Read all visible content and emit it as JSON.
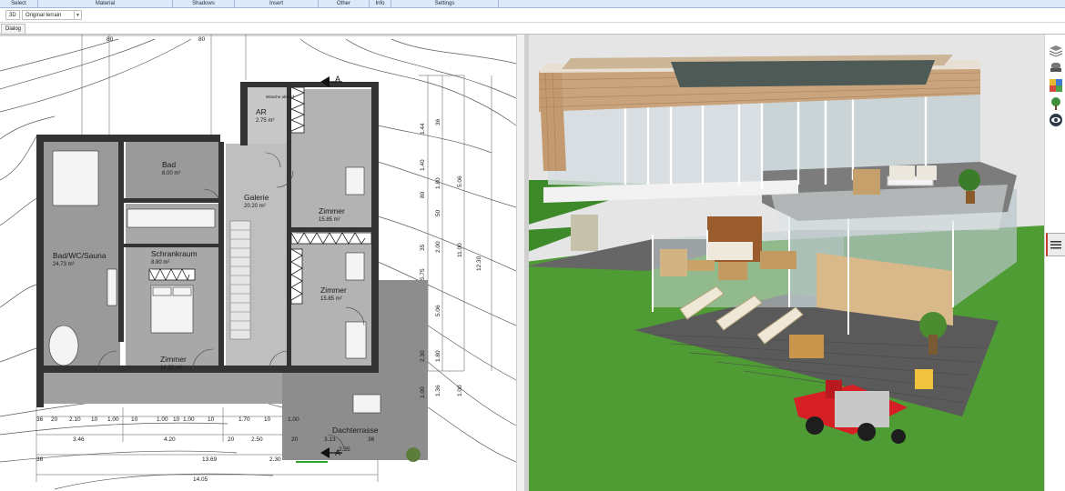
{
  "menu": {
    "items": [
      {
        "label": "Select"
      },
      {
        "label": "Material"
      },
      {
        "label": "Shadows"
      },
      {
        "label": "Insert"
      },
      {
        "label": "Other"
      },
      {
        "label": "Info"
      },
      {
        "label": "Settings"
      }
    ]
  },
  "toolbar": {
    "view_mode": "3D",
    "terrain_option": "Original terrain"
  },
  "tabs": {
    "dialog": "Dialog"
  },
  "floorplan": {
    "rooms": [
      {
        "name": "AR",
        "area": "2.75 m²"
      },
      {
        "name": "Bad",
        "area": "8.00 m²"
      },
      {
        "name": "Galerie",
        "area": "20.20 m²"
      },
      {
        "name": "Zimmer",
        "area": "15.85 m²"
      },
      {
        "name": "Bad/WC/Sauna",
        "area": "24.73 m²"
      },
      {
        "name": "Schrankraum",
        "area": "8.80 m²"
      },
      {
        "name": "Zimmer",
        "area": "15.85 m²"
      },
      {
        "name": "Zimmer",
        "area": "14.32 m²"
      },
      {
        "name": "Dachterrasse",
        "area": ""
      }
    ],
    "washer_label": "Wäsche abwurf",
    "top_dims": [
      "80",
      "80"
    ],
    "bottom_dims_row1": [
      "36",
      "20",
      "2.10",
      "10",
      "1.00",
      "10",
      "1.00",
      "10",
      "1.00",
      "10",
      "1.70",
      "10",
      "1.00",
      "2.30"
    ],
    "bottom_dims_row2": [
      "3.46",
      "4.20",
      "20",
      "2.50",
      "20",
      "3.13",
      "36"
    ],
    "bottom_dims_row3": [
      "36",
      "13.69"
    ],
    "bottom_dims_row4": [
      "14.05"
    ],
    "extra_dims": [
      "2.35",
      "2.30"
    ],
    "right_dims_col1": [
      "1.44",
      "1.40",
      "80",
      "35",
      "5.75",
      "1.00"
    ],
    "right_dims_col2": [
      "36",
      "1.80",
      "5.06",
      "1.80",
      "1.36"
    ],
    "right_dims_col3": [
      "5.06",
      "11.00",
      "1.00",
      "2.00",
      "50"
    ],
    "right_dims_far": [
      "12.30"
    ]
  },
  "colors": {
    "menubar_bg": "#dce9f8",
    "wall": "#3a3a3a",
    "floor_tile": "#8e8e8e",
    "grass": "#4a9a35",
    "deck": "#5a5a5a",
    "wood_cladding": "#c9a47c",
    "mower_red": "#d62026"
  },
  "view3d": {
    "scene": "house-3d-render"
  },
  "rightbar": {
    "icons": [
      "layers-icon",
      "furniture-icon",
      "materials-icon",
      "plant-icon",
      "eye-icon"
    ]
  }
}
